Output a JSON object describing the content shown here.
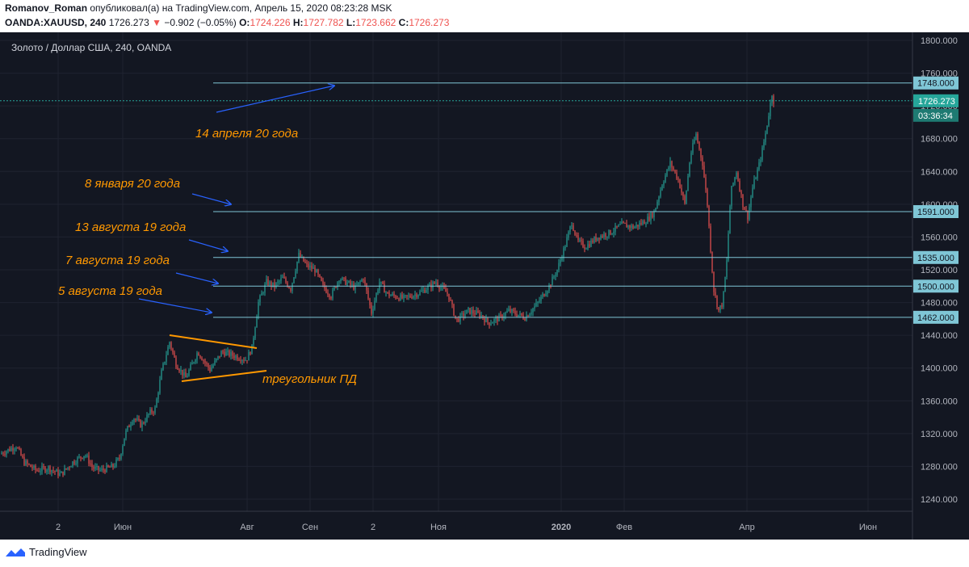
{
  "header": {
    "author": "Romanov_Roman",
    "published": "опубликовал(а) на TradingView.com, Апрель 15, 2020 08:23:28 MSK",
    "symbol": "OANDA:XAUUSD, 240",
    "last": "1726.273",
    "change": "−0.902 (−0.05%)",
    "o_label": "O:",
    "o_value": "1724.226",
    "h_label": "H:",
    "h_value": "1727.782",
    "l_label": "L:",
    "l_value": "1723.662",
    "c_label": "C:",
    "c_value": "1726.273"
  },
  "chart_title": "Золото / Доллар США, 240, OANDA",
  "footer": {
    "brand": "TradingView"
  },
  "colors": {
    "bg": "#131722",
    "up": "#26a69a",
    "down": "#ef5350",
    "level": "#7fc6d6",
    "annotation": "#ff9800",
    "arrow": "#2962ff"
  },
  "chart_data": {
    "type": "candlestick",
    "y_axis": {
      "min": 1240,
      "max": 1800,
      "ticks": [
        "1800.000",
        "1760.000",
        "1720.000",
        "1680.000",
        "1640.000",
        "1600.000",
        "1560.000",
        "1520.000",
        "1480.000",
        "1440.000",
        "1400.000",
        "1360.000",
        "1320.000",
        "1280.000",
        "1240.000"
      ]
    },
    "x_axis": {
      "ticks": [
        "2",
        "Июн",
        "Авг",
        "Сен",
        "2",
        "Ноя",
        "2020",
        "Фев",
        "Апр",
        "Июн"
      ]
    },
    "levels": [
      {
        "value": 1748,
        "label": "1748.000"
      },
      {
        "value": 1591,
        "label": "1591.000"
      },
      {
        "value": 1535,
        "label": "1535.000"
      },
      {
        "value": 1500,
        "label": "1500.000"
      },
      {
        "value": 1462,
        "label": "1462.000"
      }
    ],
    "current_price": {
      "value": 1726.273,
      "label": "1726.273",
      "countdown": "03:36:34"
    },
    "annotations": [
      "14 апреля 20 года",
      "8 января 20 года",
      "13 августа 19 года",
      "7 августа 19 года",
      "5 августа 19 года",
      "треугольник ПД"
    ],
    "path": [
      [
        0,
        1295
      ],
      [
        20,
        1305
      ],
      [
        30,
        1285
      ],
      [
        45,
        1275
      ],
      [
        60,
        1278
      ],
      [
        75,
        1270
      ],
      [
        90,
        1285
      ],
      [
        105,
        1295
      ],
      [
        115,
        1278
      ],
      [
        125,
        1275
      ],
      [
        140,
        1280
      ],
      [
        148,
        1290
      ],
      [
        155,
        1320
      ],
      [
        165,
        1340
      ],
      [
        175,
        1330
      ],
      [
        185,
        1345
      ],
      [
        192,
        1350
      ],
      [
        200,
        1395
      ],
      [
        210,
        1432
      ],
      [
        218,
        1405
      ],
      [
        230,
        1388
      ],
      [
        245,
        1420
      ],
      [
        260,
        1398
      ],
      [
        275,
        1420
      ],
      [
        290,
        1415
      ],
      [
        305,
        1410
      ],
      [
        312,
        1425
      ],
      [
        320,
        1480
      ],
      [
        330,
        1505
      ],
      [
        340,
        1500
      ],
      [
        350,
        1510
      ],
      [
        360,
        1497
      ],
      [
        370,
        1538
      ],
      [
        380,
        1525
      ],
      [
        390,
        1520
      ],
      [
        400,
        1500
      ],
      [
        410,
        1488
      ],
      [
        420,
        1510
      ],
      [
        440,
        1498
      ],
      [
        450,
        1510
      ],
      [
        460,
        1468
      ],
      [
        470,
        1505
      ],
      [
        480,
        1490
      ],
      [
        500,
        1485
      ],
      [
        520,
        1492
      ],
      [
        540,
        1505
      ],
      [
        555,
        1490
      ],
      [
        565,
        1458
      ],
      [
        580,
        1470
      ],
      [
        595,
        1465
      ],
      [
        605,
        1455
      ],
      [
        620,
        1462
      ],
      [
        630,
        1470
      ],
      [
        650,
        1462
      ],
      [
        665,
        1478
      ],
      [
        680,
        1500
      ],
      [
        690,
        1520
      ],
      [
        700,
        1550
      ],
      [
        708,
        1578
      ],
      [
        715,
        1555
      ],
      [
        725,
        1548
      ],
      [
        740,
        1560
      ],
      [
        755,
        1565
      ],
      [
        770,
        1575
      ],
      [
        785,
        1572
      ],
      [
        800,
        1580
      ],
      [
        810,
        1590
      ],
      [
        820,
        1625
      ],
      [
        830,
        1650
      ],
      [
        840,
        1630
      ],
      [
        848,
        1600
      ],
      [
        855,
        1660
      ],
      [
        862,
        1685
      ],
      [
        870,
        1650
      ],
      [
        876,
        1600
      ],
      [
        880,
        1545
      ],
      [
        884,
        1495
      ],
      [
        890,
        1470
      ],
      [
        895,
        1480
      ],
      [
        900,
        1530
      ],
      [
        905,
        1615
      ],
      [
        912,
        1640
      ],
      [
        920,
        1600
      ],
      [
        926,
        1585
      ],
      [
        932,
        1620
      ],
      [
        940,
        1648
      ],
      [
        947,
        1680
      ],
      [
        952,
        1710
      ],
      [
        956,
        1735
      ],
      [
        958,
        1726
      ]
    ]
  }
}
